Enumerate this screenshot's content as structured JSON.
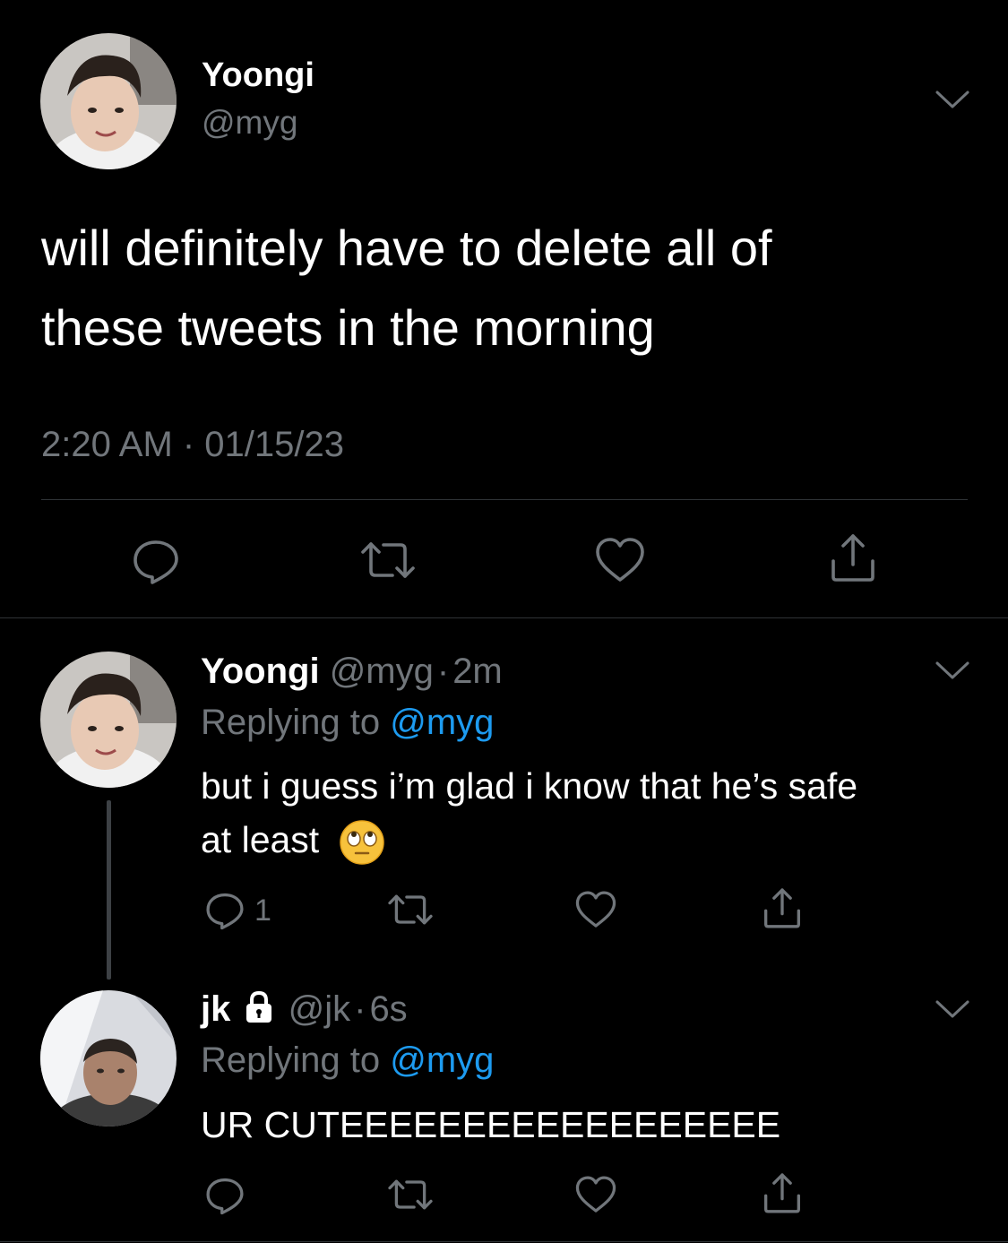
{
  "colors": {
    "background": "#000000",
    "text": "#ffffff",
    "secondary": "#71767b",
    "link": "#1d9bf0",
    "divider": "#2f3336"
  },
  "main_tweet": {
    "display_name": "Yoongi",
    "handle": "@myg",
    "text_line1": "will definitely have to delete all of",
    "text_line2": "these tweets in the morning",
    "timestamp": "2:20 AM · 01/15/23",
    "actions": [
      "reply-icon",
      "retweet-icon",
      "like-icon",
      "share-icon"
    ]
  },
  "reply1": {
    "display_name": "Yoongi",
    "handle": "@myg",
    "sep": "·",
    "time": "2m",
    "replying_prefix": "Replying to",
    "replying_to": "@myg",
    "text_line1": "but i guess i’m glad i know that he’s safe",
    "text_line2": "at least",
    "emoji": "face-with-rolling-eyes",
    "reply_count": "1"
  },
  "reply2": {
    "display_name": "jk",
    "lock_icon": "lock-icon",
    "handle": "@jk",
    "sep": "·",
    "time": "6s",
    "replying_prefix": "Replying to",
    "replying_to": "@myg",
    "text": "UR CUTEEEEEEEEEEEEEEEEEE"
  }
}
